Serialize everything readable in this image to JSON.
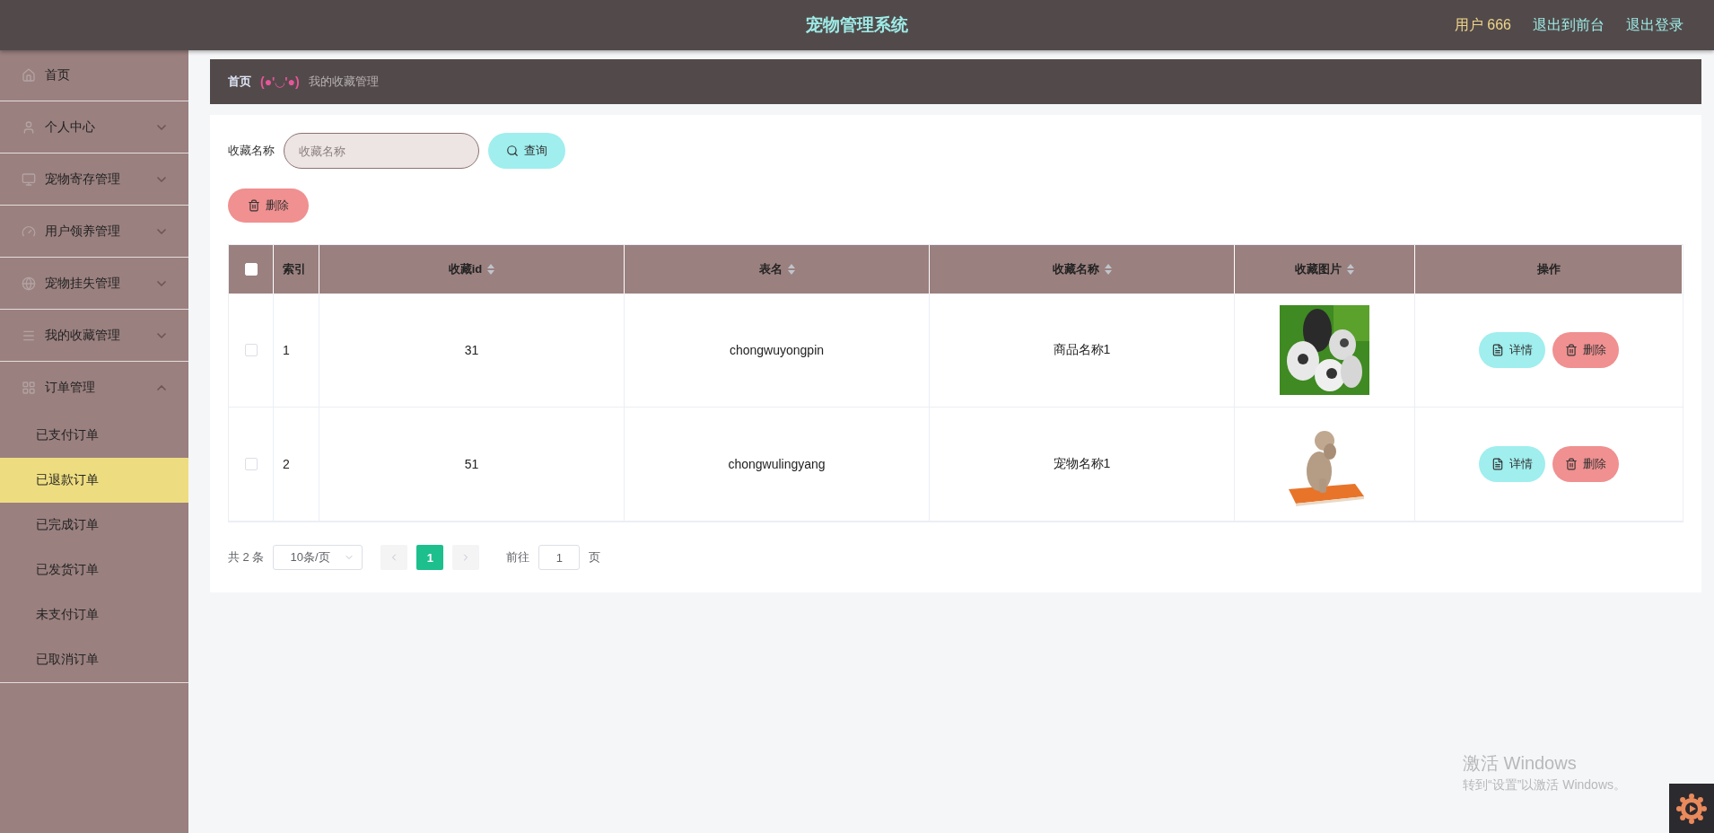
{
  "header": {
    "title": "宠物管理系统",
    "user": "用户 666",
    "links": [
      "退出到前台",
      "退出登录"
    ]
  },
  "sidebar": {
    "items": [
      {
        "label": "首页",
        "kind": "link",
        "selected": false
      },
      {
        "label": "个人中心",
        "kind": "menu",
        "expanded": false
      },
      {
        "label": "宠物寄存管理",
        "kind": "menu",
        "expanded": false
      },
      {
        "label": "用户领养管理",
        "kind": "menu",
        "expanded": false
      },
      {
        "label": "宠物挂失管理",
        "kind": "menu",
        "expanded": false
      },
      {
        "label": "我的收藏管理",
        "kind": "menu",
        "expanded": false
      },
      {
        "label": "订单管理",
        "kind": "menu",
        "expanded": true,
        "children": [
          {
            "label": "已支付订单",
            "selected": false
          },
          {
            "label": "已退款订单",
            "selected": true
          },
          {
            "label": "已完成订单",
            "selected": false
          },
          {
            "label": "已发货订单",
            "selected": false
          },
          {
            "label": "未支付订单",
            "selected": false
          },
          {
            "label": "已取消订单",
            "selected": false
          }
        ]
      }
    ]
  },
  "breadcrumb": {
    "home": "首页",
    "separator": "(●'◡'●)",
    "current": "我的收藏管理"
  },
  "search": {
    "label": "收藏名称",
    "placeholder": "收藏名称",
    "button": "查询"
  },
  "bulk_delete": "删除",
  "table": {
    "header_checked": false,
    "columns": [
      {
        "label": "索引",
        "sortable": false
      },
      {
        "label": "收藏id",
        "sortable": true
      },
      {
        "label": "表名",
        "sortable": true
      },
      {
        "label": "收藏名称",
        "sortable": true
      },
      {
        "label": "收藏图片",
        "sortable": true
      },
      {
        "label": "操作",
        "sortable": false
      }
    ],
    "rows": [
      {
        "checked": false,
        "index": "1",
        "id": "31",
        "table": "chongwuyongpin",
        "name": "商品名称1",
        "actions": [
          "详情",
          "删除"
        ]
      },
      {
        "checked": false,
        "index": "2",
        "id": "51",
        "table": "chongwulingyang",
        "name": "宠物名称1",
        "actions": [
          "详情",
          "删除"
        ]
      }
    ]
  },
  "pagination": {
    "total": "共 2 条",
    "page_size": "10条/页",
    "pages": [
      {
        "label": "1",
        "selected": true
      }
    ],
    "jump_label": "前往",
    "jump_value": "1",
    "jump_suffix": "页"
  },
  "os_notice": {
    "title": "激活 Windows",
    "subtitle": "转到“设置”以激活 Windows。"
  }
}
